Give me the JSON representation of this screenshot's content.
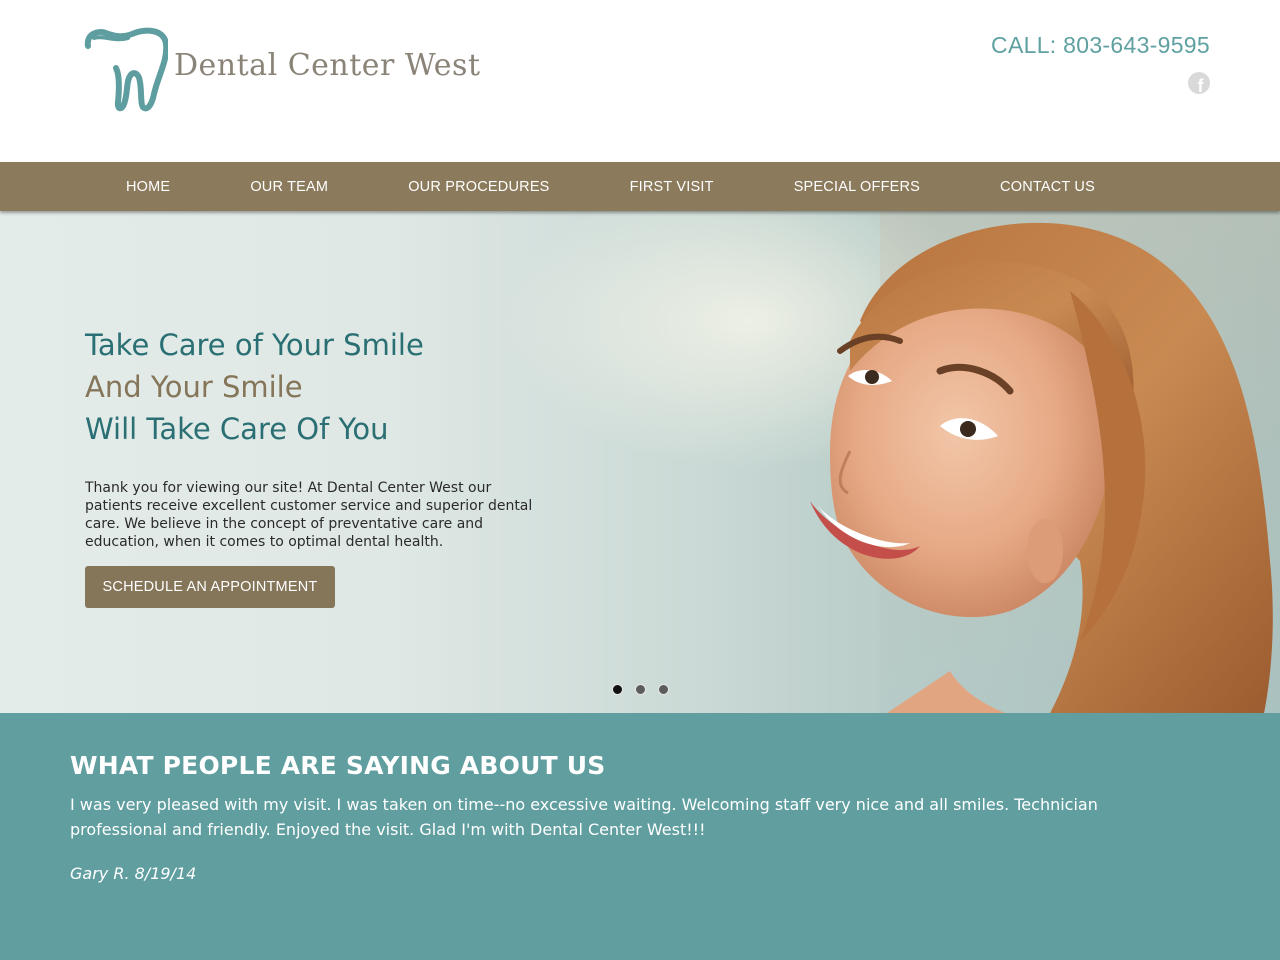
{
  "header": {
    "brand": "Dental Center West",
    "phone_text": "CALL: 803-643-9595",
    "social_icon": "facebook-icon"
  },
  "nav": {
    "items": [
      {
        "label": "HOME"
      },
      {
        "label": "OUR TEAM"
      },
      {
        "label": "OUR PROCEDURES"
      },
      {
        "label": "FIRST VISIT"
      },
      {
        "label": "SPECIAL OFFERS"
      },
      {
        "label": "CONTACT US"
      }
    ]
  },
  "hero": {
    "headline_1": "Take Care of Your Smile",
    "headline_2": "And Your Smile",
    "headline_3": "Will Take Care Of You",
    "intro": "Thank you for viewing our site! At Dental Center West our patients receive excellent customer service and superior dental care. We believe in the concept of preventative care and education, when it comes to optimal dental health.",
    "cta_label": "SCHEDULE AN APPOINTMENT",
    "slides_total": 3,
    "active_slide": 1
  },
  "testimonials": {
    "title": "WHAT PEOPLE ARE SAYING ABOUT US",
    "quote": "I was very pleased with my visit. I was taken on time--no excessive waiting. Welcoming staff very nice and all smiles. Technician professional and friendly. Enjoyed the visit. Glad I'm with Dental Center West!!!",
    "author": "Gary R. 8/19/14"
  },
  "colors": {
    "teal": "#609e9f",
    "nav_brown": "#8b7a5c",
    "headline_teal": "#2a6f73",
    "headline_brown": "#857559",
    "phone": "#5fa0a1"
  }
}
